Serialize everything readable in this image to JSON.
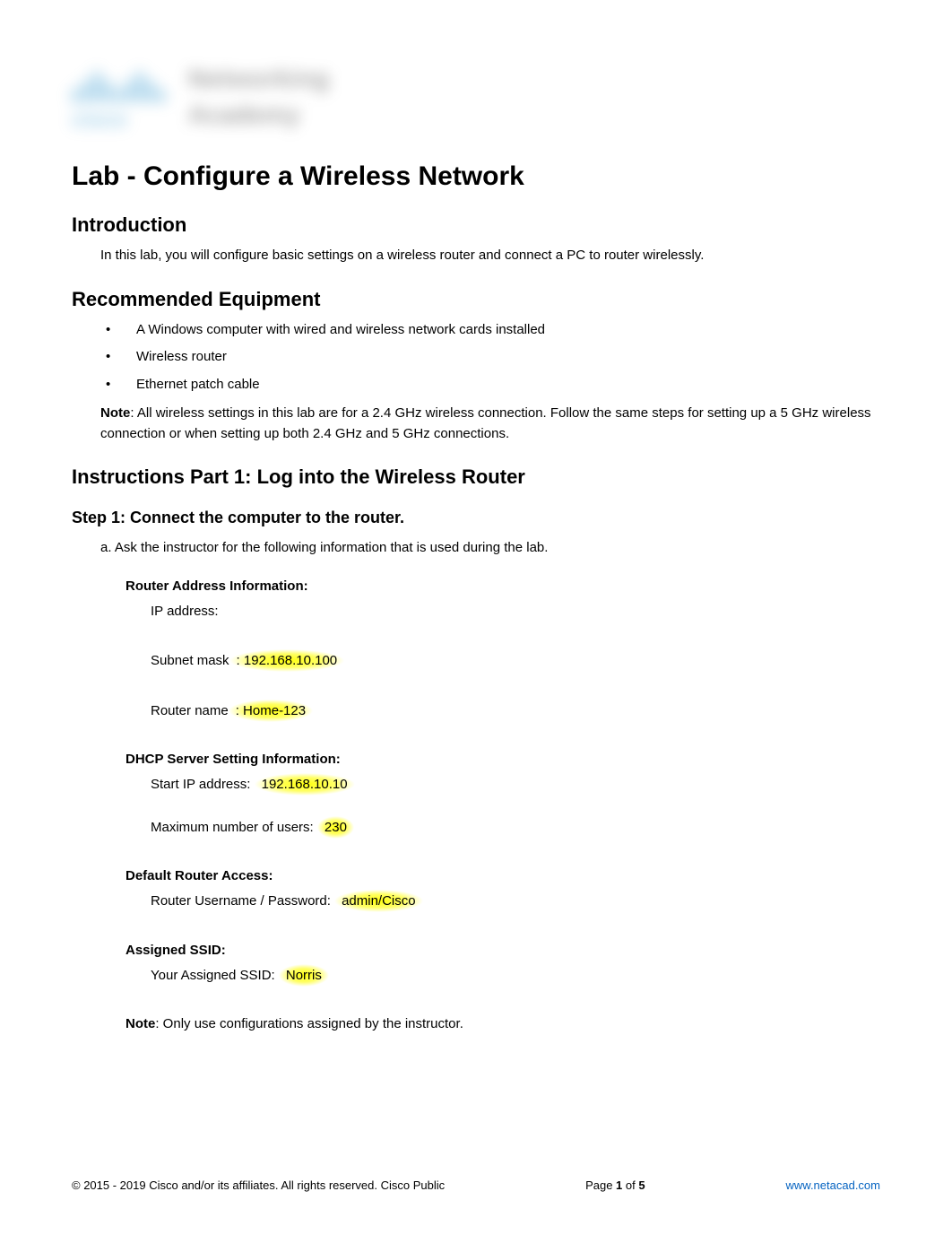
{
  "logo": {
    "top": "Networking",
    "bottom": "Academy",
    "brand": "cisco"
  },
  "title": "Lab - Configure a Wireless Network",
  "intro": {
    "heading": "Introduction",
    "text": "In this lab, you will configure basic settings on a wireless router and connect a PC to router wirelessly."
  },
  "equipment": {
    "heading": "Recommended Equipment",
    "items": [
      "A Windows computer with wired and wireless network cards installed",
      "Wireless router",
      "Ethernet patch cable"
    ],
    "note_label": "Note",
    "note_text": ": All wireless settings in this lab are for a 2.4 GHz wireless connection. Follow the same steps for setting up a 5 GHz wireless connection or when setting up both 2.4 GHz and 5 GHz connections."
  },
  "instructions": {
    "heading": "Instructions Part 1: Log into the Wireless Router",
    "step1": {
      "heading": "Step 1: Connect the computer to the router.",
      "line_a": "a. Ask the instructor for the following information that is used during the lab.",
      "router_info": {
        "heading": "Router Address Information:",
        "ip_label": "IP address:",
        "subnet_label": "Subnet mask",
        "subnet_value": ": 192.168.10.100",
        "name_label": "Router name",
        "name_value": ": Home-123"
      },
      "dhcp_info": {
        "heading": "DHCP Server Setting Information:",
        "start_label": "Start IP address: ",
        "start_value": "192.168.10.10",
        "max_label": "Maximum number of users: ",
        "max_value": "230"
      },
      "access_info": {
        "heading": "Default Router Access:",
        "label": "Router Username / Password: ",
        "value": "admin/Cisco"
      },
      "ssid_info": {
        "heading": "Assigned SSID:",
        "label": "Your Assigned SSID: ",
        "value": "Norris"
      },
      "note_label": "Note",
      "note_text": ": Only use configurations assigned by the instructor."
    }
  },
  "footer": {
    "copyright": "© 2015 - 2019 Cisco and/or its affiliates. All rights reserved. Cisco Public",
    "page_prefix": "Page ",
    "page_current": "1",
    "page_sep": " of ",
    "page_total": "5",
    "link": "www.netacad.com"
  }
}
